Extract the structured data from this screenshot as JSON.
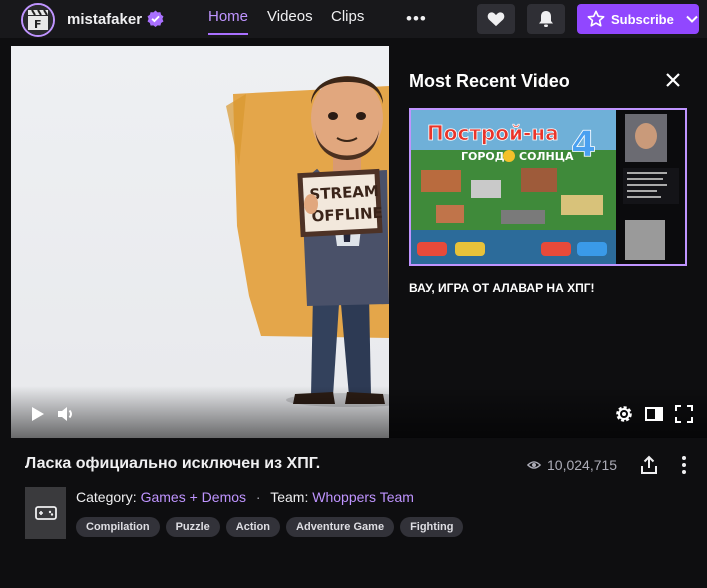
{
  "channel": {
    "name": "mistafaker",
    "verified": true
  },
  "nav": {
    "tabs": [
      {
        "label": "Home",
        "active": true
      },
      {
        "label": "Videos"
      },
      {
        "label": "Clips"
      }
    ],
    "more": "•••"
  },
  "actions": {
    "subscribe_label": "Subscribe"
  },
  "player": {
    "offline_sign": [
      "STREAM",
      "OFFLINE"
    ],
    "panel_title": "Most Recent Video",
    "thumb_text": {
      "title": "Построй-на",
      "number": "4",
      "subtitle": "ГОРОД",
      "subtitle2": "СОЛНЦА"
    },
    "panel_caption": "ВАУ, ИГРА ОТ АЛАВАР НА ХПГ!"
  },
  "info": {
    "title": "Ласка официально исключен из ХПГ.",
    "views": "10,024,715",
    "category_label": "Category:",
    "category": "Games + Demos",
    "separator": "·",
    "team_label": "Team:",
    "team": "Whoppers Team",
    "tags": [
      "Compilation",
      "Puzzle",
      "Action",
      "Adventure Game",
      "Fighting"
    ]
  },
  "colors": {
    "accent": "#9147ff",
    "link": "#bf94ff",
    "bg": "#0e0e10",
    "topbar": "#18181b"
  }
}
